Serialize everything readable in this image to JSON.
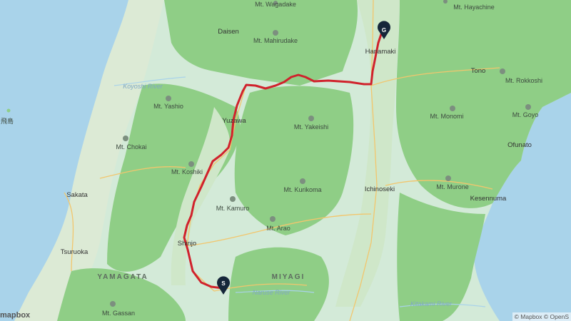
{
  "map": {
    "places": [
      {
        "id": "mt-wagadake",
        "label": "Mt. Wagadake"
      },
      {
        "id": "mt-hayachine",
        "label": "Mt. Hayachine"
      },
      {
        "id": "daisen",
        "label": "Daisen"
      },
      {
        "id": "mt-mahirudake",
        "label": "Mt. Mahirudake"
      },
      {
        "id": "hanamaki",
        "label": "Hanamaki"
      },
      {
        "id": "tono",
        "label": "Tono"
      },
      {
        "id": "mt-rokkoshi",
        "label": "Mt. Rokkoshi"
      },
      {
        "id": "mt-yashio",
        "label": "Mt. Yashio"
      },
      {
        "id": "yuzawa",
        "label": "Yuzawa"
      },
      {
        "id": "mt-yakeishi",
        "label": "Mt. Yakeishi"
      },
      {
        "id": "mt-monomi",
        "label": "Mt. Monomi"
      },
      {
        "id": "mt-goyo",
        "label": "Mt. Goyo"
      },
      {
        "id": "mt-chokai",
        "label": "Mt. Chokai"
      },
      {
        "id": "ofunato",
        "label": "Ofunato"
      },
      {
        "id": "mt-koshiki",
        "label": "Mt. Koshiki"
      },
      {
        "id": "mt-kurikoma",
        "label": "Mt. Kurikoma"
      },
      {
        "id": "ichinoseki",
        "label": "Ichinoseki"
      },
      {
        "id": "sakata",
        "label": "Sakata"
      },
      {
        "id": "mt-murone",
        "label": "Mt. Murone"
      },
      {
        "id": "kesennuma",
        "label": "Kesennuma"
      },
      {
        "id": "mt-kamuro",
        "label": "Mt. Kamuro"
      },
      {
        "id": "mt-arao",
        "label": "Mt. Arao"
      },
      {
        "id": "shinjo",
        "label": "Shinjo"
      },
      {
        "id": "tsuruoka",
        "label": "Tsuruoka"
      },
      {
        "id": "mt-gassan",
        "label": "Mt. Gassan"
      },
      {
        "id": "tobishima",
        "label": "飛島"
      }
    ],
    "prefectures": [
      {
        "id": "yamagata",
        "label": "YAMAGATA"
      },
      {
        "id": "miyagi",
        "label": "MIYAGI"
      }
    ],
    "rivers": [
      {
        "id": "koyoshi",
        "label": "Koyoshi River"
      },
      {
        "id": "naruse",
        "label": "Naruse River"
      },
      {
        "id": "kitakami",
        "label": "Kitakami River"
      }
    ],
    "route": {
      "color": "#d0222c"
    },
    "start_marker": {
      "label": "S"
    },
    "goal_marker": {
      "label": "G"
    },
    "colors": {
      "water": "#a9d3ea",
      "land_low": "#d8ead7",
      "forest": "#8fce86",
      "road": "#f2c66d"
    }
  },
  "attribution": "© Mapbox © OpenS",
  "logo": "mapbox"
}
